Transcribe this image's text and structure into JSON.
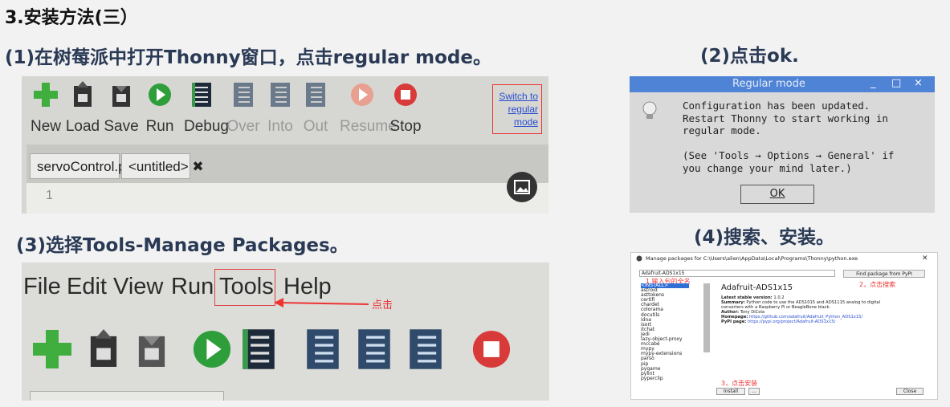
{
  "heading": "3.安装方法(三）",
  "step1": {
    "caption": "(1)在树莓派中打开Thonny窗口，点击regular mode。"
  },
  "step2": {
    "caption": "(2)点击ok."
  },
  "step3": {
    "caption": "(3)选择Tools-Manage Packages。"
  },
  "step4": {
    "caption": "(4)搜索、安装。"
  },
  "thonny_toolbar": {
    "buttons": [
      "New",
      "Load",
      "Save",
      "Run",
      "Debug",
      "Over",
      "Into",
      "Out",
      "Resume",
      "Stop"
    ],
    "switch_link": [
      "Switch to",
      "regular mode"
    ],
    "tabs": [
      "servoControl.py ✖",
      "<untitled> ✖"
    ],
    "line_number": "1"
  },
  "regular_mode_dialog": {
    "title": "Regular mode",
    "message": "Configuration has been updated.\nRestart Thonny to start working in\nregular mode.\n\n(See 'Tools → Options → General' if\nyou change your mind later.)",
    "ok_label": "OK",
    "window_controls": [
      "_",
      "□",
      "×"
    ]
  },
  "menu_bar": {
    "items": [
      "File",
      "Edit",
      "View",
      "Run",
      "Tools",
      "Help"
    ],
    "note": "点击"
  },
  "manage_packages": {
    "title": "Manage packages for C:\\Users\\alien\\AppData\\Local\\Programs\\Thonny\\python.exe",
    "search_value": "Adafruit-ADS1x15",
    "find_button": "Find package from PyPI",
    "step1_note": "1.输入包的全名",
    "step2_note": "2，点击搜索",
    "step3_note": "3，点击安装",
    "list": [
      "<INSTALL>",
      "astroid",
      "asttokens",
      "certifi",
      "chardet",
      "colorama",
      "docutils",
      "idna",
      "isort",
      "itchat",
      "jedi",
      "lazy-object-proxy",
      "mccabe",
      "mypy",
      "mypy-extensions",
      "parso",
      "pip",
      "pygame",
      "pylint",
      "pyperclip"
    ],
    "package_name": "Adafruit-ADS1x15",
    "latest_label": "Latest stable version:",
    "latest_value": "1.0.2",
    "summary_label": "Summary:",
    "summary_value": "Python code to use the ADS1015 and ADS1115 analog to digital converters with a Raspberry Pi or BeagleBone black.",
    "author_label": "Author:",
    "author_value": "Tony DiCola",
    "homepage_label": "Homepage:",
    "homepage_value": "https://github.com/adafruit/Adafruit_Python_ADS1x15/",
    "pypi_label": "PyPI page:",
    "pypi_value": "https://pypi.org/project/Adafruit-ADS1x15/",
    "install_button": "Install",
    "more_button": "...",
    "close_button": "Close"
  }
}
